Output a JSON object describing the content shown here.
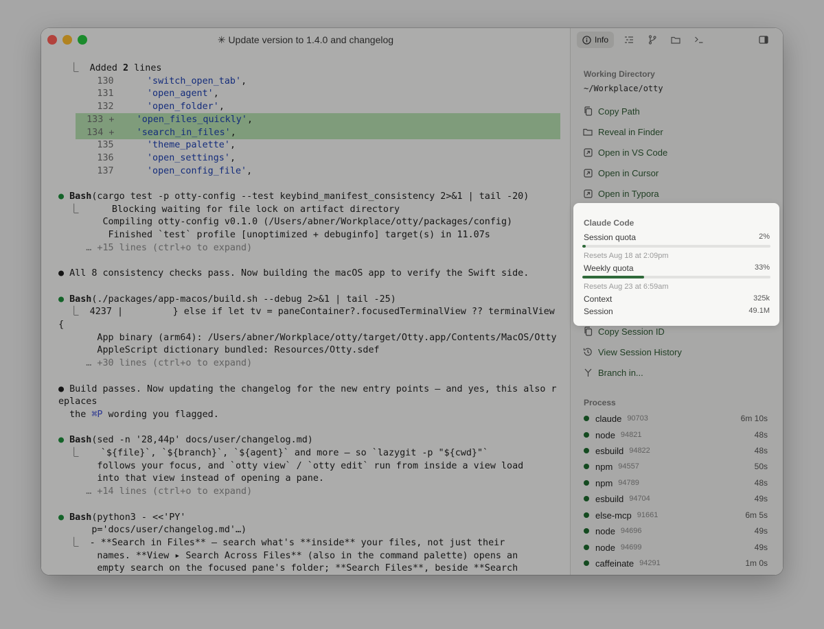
{
  "window": {
    "title": "✳ Update version to 1.4.0 and changelog"
  },
  "terminal": {
    "lines": [
      {
        "segs": [
          {
            "t": "  ⎿  Added "
          },
          {
            "t": "2",
            "c": "kw"
          },
          {
            "t": " lines"
          }
        ]
      },
      {
        "segs": [
          {
            "t": "       130      ",
            "c": "num"
          },
          {
            "t": "'switch_open_tab'",
            "c": "str"
          },
          {
            "t": ","
          }
        ]
      },
      {
        "segs": [
          {
            "t": "       131      ",
            "c": "num"
          },
          {
            "t": "'open_agent'",
            "c": "str"
          },
          {
            "t": ","
          }
        ]
      },
      {
        "segs": [
          {
            "t": "       132      ",
            "c": "num"
          },
          {
            "t": "'open_folder'",
            "c": "str"
          },
          {
            "t": ","
          }
        ]
      },
      {
        "add": true,
        "segs": [
          {
            "t": "  133 +    ",
            "c": "num"
          },
          {
            "t": "'open_files_quickly'",
            "c": "str"
          },
          {
            "t": ","
          }
        ]
      },
      {
        "add": true,
        "segs": [
          {
            "t": "  134 +    ",
            "c": "num"
          },
          {
            "t": "'search_in_files'",
            "c": "str"
          },
          {
            "t": ","
          }
        ]
      },
      {
        "segs": [
          {
            "t": "       135      ",
            "c": "num"
          },
          {
            "t": "'theme_palette'",
            "c": "str"
          },
          {
            "t": ","
          }
        ]
      },
      {
        "segs": [
          {
            "t": "       136      ",
            "c": "num"
          },
          {
            "t": "'open_settings'",
            "c": "str"
          },
          {
            "t": ","
          }
        ]
      },
      {
        "segs": [
          {
            "t": "       137      ",
            "c": "num"
          },
          {
            "t": "'open_config_file'",
            "c": "str"
          },
          {
            "t": ","
          }
        ]
      },
      {
        "segs": []
      },
      {
        "bullet": "green",
        "segs": [
          {
            "t": "Bash",
            "c": "kw"
          },
          {
            "t": "(cargo test -p otty-config --test keybind_manifest_consistency 2>&1 | tail -20)"
          }
        ]
      },
      {
        "segs": [
          {
            "t": "  ⎿      Blocking waiting for file lock on artifact directory"
          }
        ]
      },
      {
        "segs": [
          {
            "t": "        Compiling otty-config v0.1.0 (/Users/abner/Workplace/otty/packages/config)"
          }
        ]
      },
      {
        "segs": [
          {
            "t": "         Finished `test` profile [unoptimized + debuginfo] target(s) in 11.07s"
          }
        ]
      },
      {
        "muted": true,
        "segs": [
          {
            "t": "     … +15 lines (ctrl+o to expand)"
          }
        ]
      },
      {
        "segs": []
      },
      {
        "bullet": "plain",
        "segs": [
          {
            "t": "All 8 consistency checks pass. Now building the macOS app to verify the Swift side."
          }
        ]
      },
      {
        "segs": []
      },
      {
        "bullet": "green",
        "segs": [
          {
            "t": "Bash",
            "c": "kw"
          },
          {
            "t": "(./packages/app-macos/build.sh --debug 2>&1 | tail -25)"
          }
        ]
      },
      {
        "segs": [
          {
            "t": "  ⎿  4237 |         } else if let tv = paneContainer?.focusedTerminalView ?? terminalView"
          }
        ]
      },
      {
        "segs": [
          {
            "t": "{"
          }
        ]
      },
      {
        "segs": [
          {
            "t": "       App binary (arm64): /Users/abner/Workplace/otty/target/Otty.app/Contents/MacOS/Otty"
          }
        ]
      },
      {
        "segs": [
          {
            "t": "       AppleScript dictionary bundled: Resources/Otty.sdef"
          }
        ]
      },
      {
        "muted": true,
        "segs": [
          {
            "t": "     … +30 lines (ctrl+o to expand)"
          }
        ]
      },
      {
        "segs": []
      },
      {
        "bullet": "plain",
        "segs": [
          {
            "t": "Build passes. Now updating the changelog for the new entry points — and yes, this also r"
          }
        ]
      },
      {
        "segs": [
          {
            "t": "eplaces"
          }
        ]
      },
      {
        "segs": [
          {
            "t": "  the "
          },
          {
            "t": "⌘P",
            "c": "kbd"
          },
          {
            "t": " wording you flagged."
          }
        ]
      },
      {
        "segs": []
      },
      {
        "bullet": "green",
        "segs": [
          {
            "t": "Bash",
            "c": "kw"
          },
          {
            "t": "(sed -n '28,44p' docs/user/changelog.md)"
          }
        ]
      },
      {
        "segs": [
          {
            "t": "  ⎿    `${file}`, `${branch}`, `${agent}` and more — so `lazygit -p \"${cwd}\"`"
          }
        ]
      },
      {
        "segs": [
          {
            "t": "       follows your focus, and `otty view` / `otty edit` run from inside a view load"
          }
        ]
      },
      {
        "segs": [
          {
            "t": "       into that view instead of opening a pane."
          }
        ]
      },
      {
        "muted": true,
        "segs": [
          {
            "t": "     … +14 lines (ctrl+o to expand)"
          }
        ]
      },
      {
        "segs": []
      },
      {
        "bullet": "green",
        "segs": [
          {
            "t": "Bash",
            "c": "kw"
          },
          {
            "t": "(python3 - <<'PY'"
          }
        ]
      },
      {
        "segs": [
          {
            "t": "      p='docs/user/changelog.md'…)"
          }
        ]
      },
      {
        "segs": [
          {
            "t": "  ⎿  - **Search in Files** — search what's **inside** your files, not just their"
          }
        ]
      },
      {
        "segs": [
          {
            "t": "       names. **View ▸ Search Across Files** (also in the command palette) opens an"
          }
        ]
      },
      {
        "segs": [
          {
            "t": "       empty search on the focused pane's folder; **Search Files**, beside **Search"
          }
        ]
      }
    ]
  },
  "sidebar": {
    "toolbar": {
      "info_label": "Info"
    },
    "working_directory": {
      "heading": "Working Directory",
      "path": "~/Workplace/otty"
    },
    "actions": [
      {
        "icon": "copy-icon",
        "label": "Copy Path"
      },
      {
        "icon": "folder-icon",
        "label": "Reveal in Finder"
      },
      {
        "icon": "external-link-icon",
        "label": "Open in VS Code"
      },
      {
        "icon": "external-link-icon",
        "label": "Open in Cursor"
      },
      {
        "icon": "external-link-icon",
        "label": "Open in Typora"
      }
    ],
    "session_actions": [
      {
        "icon": "copy-icon",
        "label": "Copy Session ID"
      },
      {
        "icon": "history-icon",
        "label": "View Session History"
      },
      {
        "icon": "branch-icon",
        "label": "Branch in..."
      }
    ],
    "process": {
      "heading": "Process",
      "items": [
        {
          "name": "claude",
          "pid": "90703",
          "time": "6m 10s"
        },
        {
          "name": "node",
          "pid": "94821",
          "time": "48s"
        },
        {
          "name": "esbuild",
          "pid": "94822",
          "time": "48s"
        },
        {
          "name": "npm",
          "pid": "94557",
          "time": "50s"
        },
        {
          "name": "npm",
          "pid": "94789",
          "time": "48s"
        },
        {
          "name": "esbuild",
          "pid": "94704",
          "time": "49s"
        },
        {
          "name": "else-mcp",
          "pid": "91661",
          "time": "6m 5s"
        },
        {
          "name": "node",
          "pid": "94696",
          "time": "49s"
        },
        {
          "name": "node",
          "pid": "94699",
          "time": "49s"
        },
        {
          "name": "caffeinate",
          "pid": "94291",
          "time": "1m 0s"
        }
      ]
    }
  },
  "claude_code": {
    "title": "Claude Code",
    "session_quota": {
      "label": "Session quota",
      "value": "2%",
      "fraction": 0.02,
      "resets": "Resets Aug 18 at 2:09pm"
    },
    "weekly_quota": {
      "label": "Weekly quota",
      "value": "33%",
      "fraction": 0.33,
      "resets": "Resets Aug 23 at 6:59am"
    },
    "context": {
      "label": "Context",
      "value": "325k"
    },
    "session": {
      "label": "Session",
      "value": "49.1M"
    }
  },
  "colors": {
    "accent_green": "#2f6a3a",
    "diff_add_bg": "#b6e0b0",
    "string_blue": "#1d3fb0"
  }
}
